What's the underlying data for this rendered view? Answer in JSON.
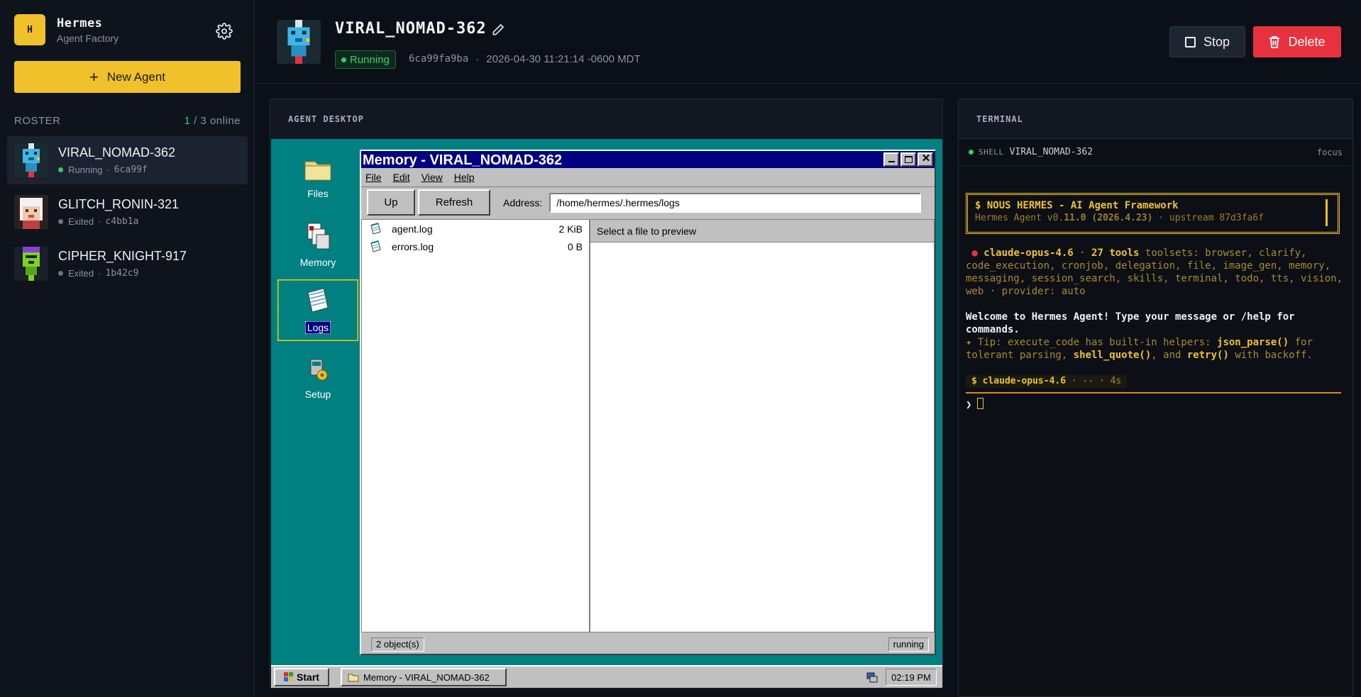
{
  "app": {
    "name": "Hermes",
    "subtitle": "Agent Factory",
    "logo_letter": "H",
    "accent": "#f0c12a"
  },
  "sidebar": {
    "new_agent_label": "New Agent",
    "roster_label": "ROSTER",
    "online_count": "1",
    "online_total": " / 3 online",
    "agents": [
      {
        "name": "VIRAL_NOMAD-362",
        "status": "Running",
        "hash": "6ca99f",
        "active": true
      },
      {
        "name": "GLITCH_RONIN-321",
        "status": "Exited",
        "hash": "c4bb1a",
        "active": false
      },
      {
        "name": "CIPHER_KNIGHT-917",
        "status": "Exited",
        "hash": "1b42c9",
        "active": false
      }
    ]
  },
  "header": {
    "title": "VIRAL_NOMAD-362",
    "status": "Running",
    "hash": "6ca99fa9ba",
    "sep": "·",
    "timestamp": "2026-04-30 11:21:14 -0600 MDT",
    "stop_label": "Stop",
    "delete_label": "Delete"
  },
  "desktop": {
    "panel_title": "AGENT DESKTOP",
    "icons": [
      {
        "label": "Files",
        "icon": "folder-icon"
      },
      {
        "label": "Memory",
        "icon": "memory-icon"
      },
      {
        "label": "Logs",
        "icon": "notepad-icon",
        "selected": true
      },
      {
        "label": "Setup",
        "icon": "setup-icon"
      }
    ],
    "window": {
      "title": "Memory - VIRAL_NOMAD-362",
      "menu": [
        "File",
        "Edit",
        "View",
        "Help"
      ],
      "up_label": "Up",
      "refresh_label": "Refresh",
      "address_label": "Address:",
      "address": "/home/hermes/.hermes/logs",
      "files": [
        {
          "name": "agent.log",
          "size": "2 KiB"
        },
        {
          "name": "errors.log",
          "size": "0 B"
        }
      ],
      "preview_placeholder": "Select a file to preview",
      "status_left": "2 object(s)",
      "status_right": "running"
    },
    "taskbar": {
      "start_label": "Start",
      "task_label": "Memory - VIRAL_NOMAD-362",
      "clock": "02:19 PM"
    }
  },
  "terminal": {
    "panel_title": "TERMINAL",
    "shell_tag": "SHELL",
    "shell_name": "VIRAL_NOMAD-362",
    "focus_label": "focus",
    "banner_line1": "$ NOUS HERMES - AI Agent Framework",
    "banner_line2a": "Hermes Agent v0.",
    "banner_line2b": "11.0 (2026.4.23)",
    "banner_line2c": " · upstream 87d3fa6f",
    "model": "claude-opus-4.6",
    "dot_sep": " · ",
    "tools": "27 tools",
    "toolsets_label": " toolsets: ",
    "toolsets": "browser, clarify, code_execution, cronjob, delegation, file, image_gen, memory, messaging, session_search, skills, terminal, todo, tts, vision, web",
    "provider": " · provider: auto",
    "welcome": "Welcome to Hermes Agent! Type your message or /help for commands.",
    "tip_prefix": "✦ Tip: execute_code has built-in helpers: ",
    "tip_fn1": "json_parse()",
    "tip_mid1": " for tolerant parsing, ",
    "tip_fn2": "shell_quote()",
    "tip_mid2": ", and ",
    "tip_fn3": "retry()",
    "tip_end": " with backoff.",
    "prompt_dollar": "$ ",
    "prompt_model": "claude-opus-4.6",
    "prompt_tail": " · -- · 4s",
    "caret": "❯"
  },
  "colors": {
    "running": "#2fd06a",
    "exited": "#6b7280",
    "delete": "#e8313e",
    "teal": "#008080",
    "win_title": "#000080"
  }
}
